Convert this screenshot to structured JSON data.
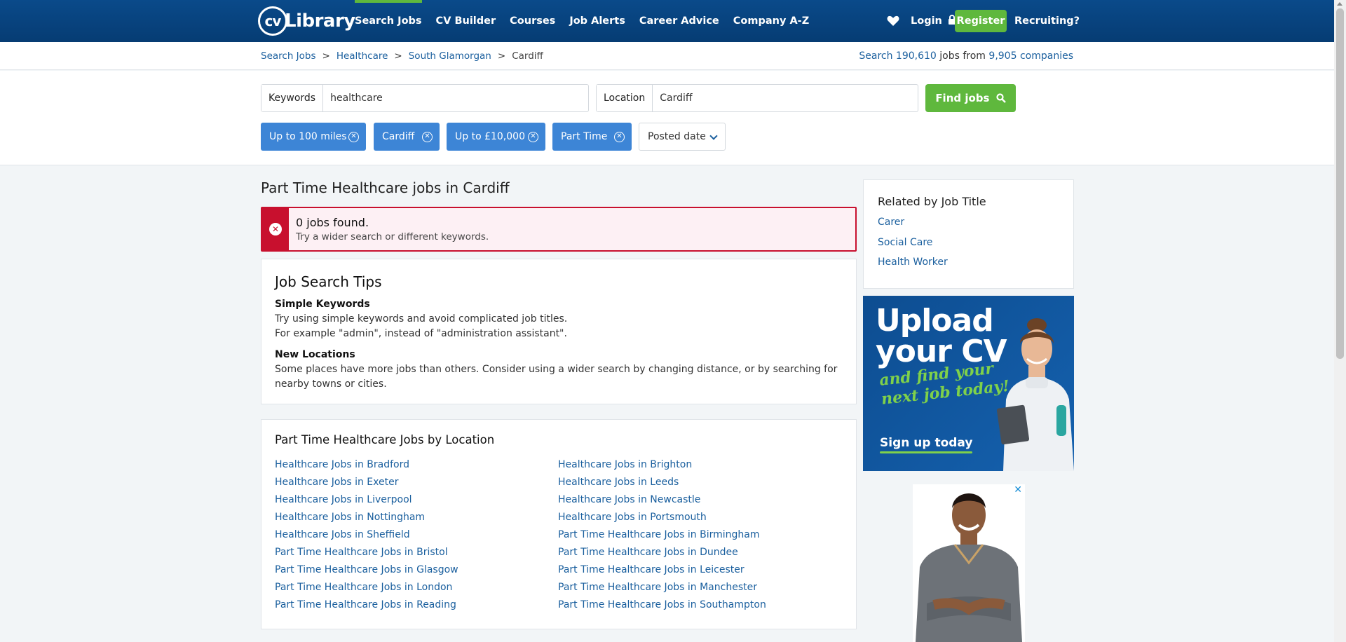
{
  "header": {
    "logo_text": "CV-Library",
    "nav": [
      "Search Jobs",
      "CV Builder",
      "Courses",
      "Job Alerts",
      "Career Advice",
      "Company A-Z"
    ],
    "login": "Login",
    "register": "Register",
    "recruiting": "Recruiting?"
  },
  "breadcrumb": {
    "items": [
      "Search Jobs",
      "Healthcare",
      "South Glamorgan"
    ],
    "current": "Cardiff",
    "stats_prefix": "Search ",
    "jobs_count": "190,610",
    "stats_mid": " jobs from ",
    "companies_count": "9,905",
    "stats_suffix": " companies"
  },
  "search": {
    "keywords_label": "Keywords",
    "keywords_value": "healthcare",
    "location_label": "Location",
    "location_value": "Cardiff",
    "find_button": "Find jobs",
    "filters": [
      "Up to 100 miles",
      "Cardiff",
      "Up to £10,000",
      "Part Time"
    ],
    "date_select": "Posted date"
  },
  "main": {
    "title": "Part Time Healthcare jobs in Cardiff",
    "alert_heading": "0 jobs found.",
    "alert_text": "Try a wider search or different keywords.",
    "tips_title": "Job Search Tips",
    "tip1_heading": "Simple Keywords",
    "tip1_line1": "Try using simple keywords and avoid complicated job titles.",
    "tip1_line2": "For example \"admin\", instead of \"administration assistant\".",
    "tip2_heading": "New Locations",
    "tip2_text": "Some places have more jobs than others. Consider using a wider search by changing distance, or by searching for nearby towns or cities.",
    "byloc_title": "Part Time Healthcare Jobs by Location",
    "locations_left": [
      "Healthcare Jobs in Bradford",
      "Healthcare Jobs in Exeter",
      "Healthcare Jobs in Liverpool",
      "Healthcare Jobs in Nottingham",
      "Healthcare Jobs in Sheffield",
      "Part Time Healthcare Jobs in Bristol",
      "Part Time Healthcare Jobs in Glasgow",
      "Part Time Healthcare Jobs in London",
      "Part Time Healthcare Jobs in Reading"
    ],
    "locations_right": [
      "Healthcare Jobs in Brighton",
      "Healthcare Jobs in Leeds",
      "Healthcare Jobs in Newcastle",
      "Healthcare Jobs in Portsmouth",
      "Part Time Healthcare Jobs in Birmingham",
      "Part Time Healthcare Jobs in Dundee",
      "Part Time Healthcare Jobs in Leicester",
      "Part Time Healthcare Jobs in Manchester",
      "Part Time Healthcare Jobs in Southampton"
    ]
  },
  "sidebar": {
    "related_title": "Related by Job Title",
    "related": [
      "Carer",
      "Social Care",
      "Health Worker"
    ],
    "ad_line1": "Upload",
    "ad_line2": "your CV",
    "ad_tag1": "and find your",
    "ad_tag2": "next job today!",
    "ad_cta": "Sign up today",
    "ad2_close": "✕"
  },
  "colors": {
    "nav_blue": "#063c73",
    "accent_green": "#5fb83d",
    "chip_blue": "#3d85d6",
    "alert_red": "#c8102e",
    "link_blue": "#1a5f9e"
  }
}
